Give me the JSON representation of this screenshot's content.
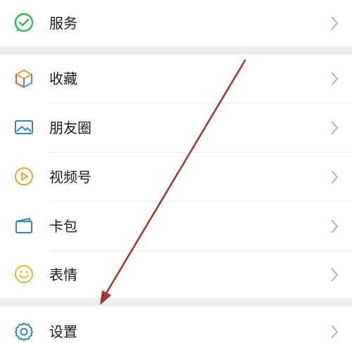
{
  "menu": {
    "items": [
      {
        "label": "服务",
        "icon": "wechat-pay-icon"
      },
      {
        "label": "收藏",
        "icon": "cube-icon"
      },
      {
        "label": "朋友圈",
        "icon": "image-icon"
      },
      {
        "label": "视频号",
        "icon": "play-circle-icon"
      },
      {
        "label": "卡包",
        "icon": "wallet-icon"
      },
      {
        "label": "表情",
        "icon": "smiley-icon"
      },
      {
        "label": "设置",
        "icon": "gear-icon"
      }
    ]
  },
  "colors": {
    "arrow": "#a6332c",
    "section_gap": "#ededed",
    "chevron": "#b3b3b3"
  }
}
